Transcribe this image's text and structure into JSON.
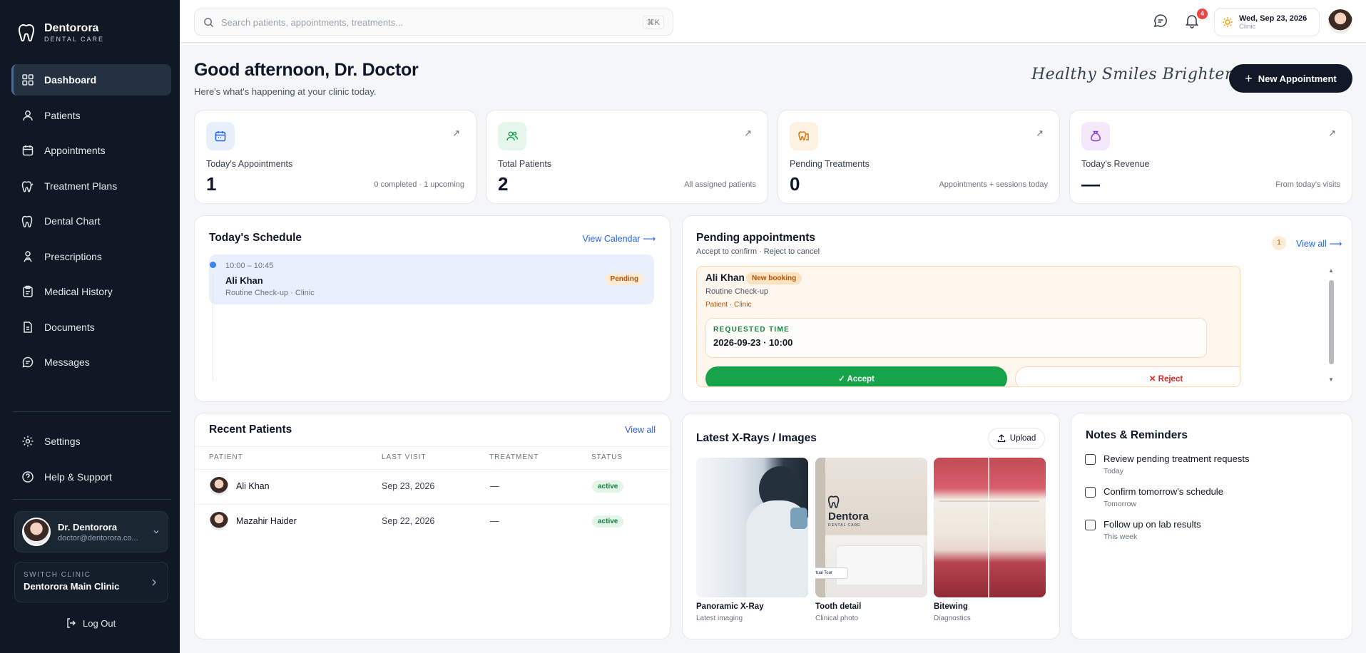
{
  "brand": {
    "name": "Dentorora",
    "sub": "DENTAL CARE"
  },
  "sidebar": {
    "items": [
      {
        "label": "Dashboard",
        "icon": "grid-icon"
      },
      {
        "label": "Patients",
        "icon": "user-icon"
      },
      {
        "label": "Appointments",
        "icon": "calendar-icon"
      },
      {
        "label": "Treatment Plans",
        "icon": "tooth-plan-icon"
      },
      {
        "label": "Dental Chart",
        "icon": "tooth-icon"
      },
      {
        "label": "Prescriptions",
        "icon": "prescription-icon"
      },
      {
        "label": "Medical History",
        "icon": "clipboard-icon"
      },
      {
        "label": "Documents",
        "icon": "document-icon"
      },
      {
        "label": "Messages",
        "icon": "message-icon"
      }
    ],
    "bottom": [
      {
        "label": "Settings",
        "icon": "gear-icon"
      },
      {
        "label": "Help & Support",
        "icon": "help-icon"
      }
    ],
    "user": {
      "name": "Dr. Dentorora",
      "email": "doctor@dentorora.co..."
    },
    "clinic": {
      "label": "SWITCH CLINIC",
      "name": "Dentorora Main Clinic"
    },
    "logout": "Log Out"
  },
  "topbar": {
    "search_placeholder": "Search patients, appointments, treatments...",
    "shortcut": "⌘K",
    "notification_count": "4",
    "date": "Wed, Sep 23, 2026",
    "date_sub": "Clinic"
  },
  "header": {
    "greeting": "Good afternoon, Dr. Doctor",
    "subtitle": "Here's what's happening at your clinic today.",
    "tagline": "Healthy Smiles Brighter Lives",
    "new_appointment": "New Appointment"
  },
  "stats": [
    {
      "label": "Today's Appointments",
      "value": "1",
      "note": "0 completed · 1 upcoming",
      "icon": "calendar-icon",
      "color": "#2563eb",
      "bg": "#e7effb"
    },
    {
      "label": "Total Patients",
      "value": "2",
      "note": "All assigned patients",
      "icon": "users-icon",
      "color": "#16a34a",
      "bg": "#e6f6ec"
    },
    {
      "label": "Pending Treatments",
      "value": "0",
      "note": "Appointments + sessions today",
      "icon": "clipboard-tooth-icon",
      "color": "#d97706",
      "bg": "#fdf1e2"
    },
    {
      "label": "Today's Revenue",
      "value": "—",
      "note": "From today's visits",
      "icon": "money-bag-icon",
      "color": "#9333ea",
      "bg": "#f4e8fb"
    }
  ],
  "schedule": {
    "title": "Today's Schedule",
    "view_calendar": "View Calendar ⟶",
    "item": {
      "time": "10:00 – 10:45",
      "patient": "Ali Khan",
      "detail": "Routine Check-up · Clinic",
      "status": "Pending"
    }
  },
  "pending": {
    "title": "Pending appointments",
    "subtitle": "Accept to confirm · Reject to cancel",
    "count": "1",
    "view_all": "View all ⟶",
    "item": {
      "patient": "Ali Khan",
      "badge": "New booking",
      "treatment": "Routine Check-up",
      "meta": "Patient · Clinic",
      "requested_label": "REQUESTED TIME",
      "requested_time": "2026-09-23 · 10:00",
      "accept": "Accept",
      "reject": "Reject"
    }
  },
  "recent": {
    "title": "Recent Patients",
    "view_all": "View all",
    "columns": [
      "PATIENT",
      "LAST VISIT",
      "TREATMENT",
      "STATUS"
    ],
    "rows": [
      {
        "name": "Ali Khan",
        "last_visit": "Sep 23, 2026",
        "treatment": "—",
        "status": "active"
      },
      {
        "name": "Mazahir Haider",
        "last_visit": "Sep 22, 2026",
        "treatment": "—",
        "status": "active"
      }
    ]
  },
  "xrays": {
    "title": "Latest X-Rays / Images",
    "upload": "Upload",
    "images": [
      {
        "title": "Panoramic X-Ray",
        "sub": "Latest imaging"
      },
      {
        "title": "Tooth detail",
        "sub": "Clinical photo",
        "logo": "Dentora",
        "logo_sub": "DENTAL CARE",
        "sign": "rtual Tour"
      },
      {
        "title": "Bitewing",
        "sub": "Diagnostics"
      }
    ]
  },
  "notes": {
    "title": "Notes & Reminders",
    "items": [
      {
        "text": "Review pending treatment requests",
        "when": "Today"
      },
      {
        "text": "Confirm tomorrow's schedule",
        "when": "Tomorrow"
      },
      {
        "text": "Follow up on lab results",
        "when": "This week"
      }
    ]
  }
}
